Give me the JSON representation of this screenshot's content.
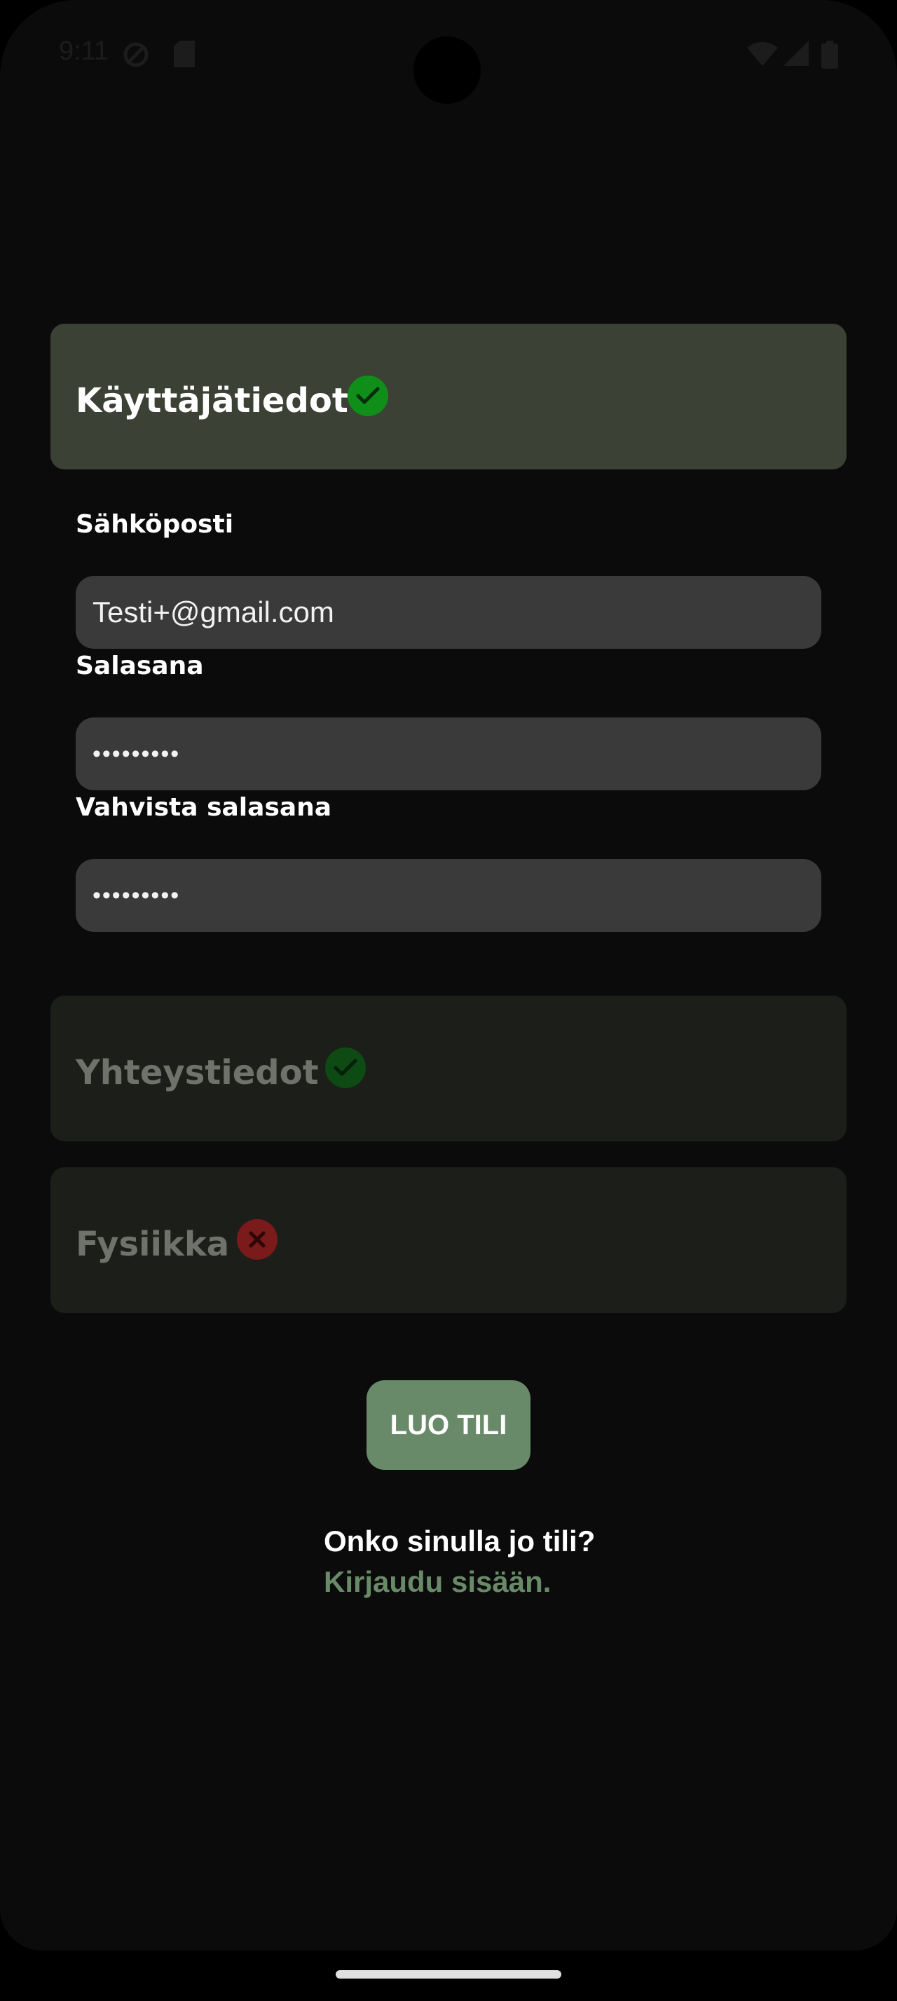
{
  "status_bar": {
    "time": "9:11"
  },
  "sections": {
    "user": {
      "title": "Käyttäjätiedot",
      "status": "complete"
    },
    "contact": {
      "title": "Yhteystiedot",
      "status": "complete"
    },
    "physics": {
      "title": "Fysiikka",
      "status": "incomplete"
    }
  },
  "form": {
    "email": {
      "label": "Sähköposti",
      "value": "Testi+@gmail.com"
    },
    "password": {
      "label": "Salasana",
      "value": "•••••••••"
    },
    "confirm_password": {
      "label": "Vahvista salasana",
      "value": "•••••••••"
    }
  },
  "actions": {
    "create_account": "LUO TILI",
    "have_account": "Onko sinulla jo tili?",
    "login_link": "Kirjaudu sisään."
  },
  "colors": {
    "accent": "#698a69",
    "success": "#0f8f1a",
    "error": "#7a1a1a"
  },
  "icons": [
    "check-icon",
    "close-icon",
    "wifi-icon",
    "signal-icon",
    "battery-icon"
  ]
}
